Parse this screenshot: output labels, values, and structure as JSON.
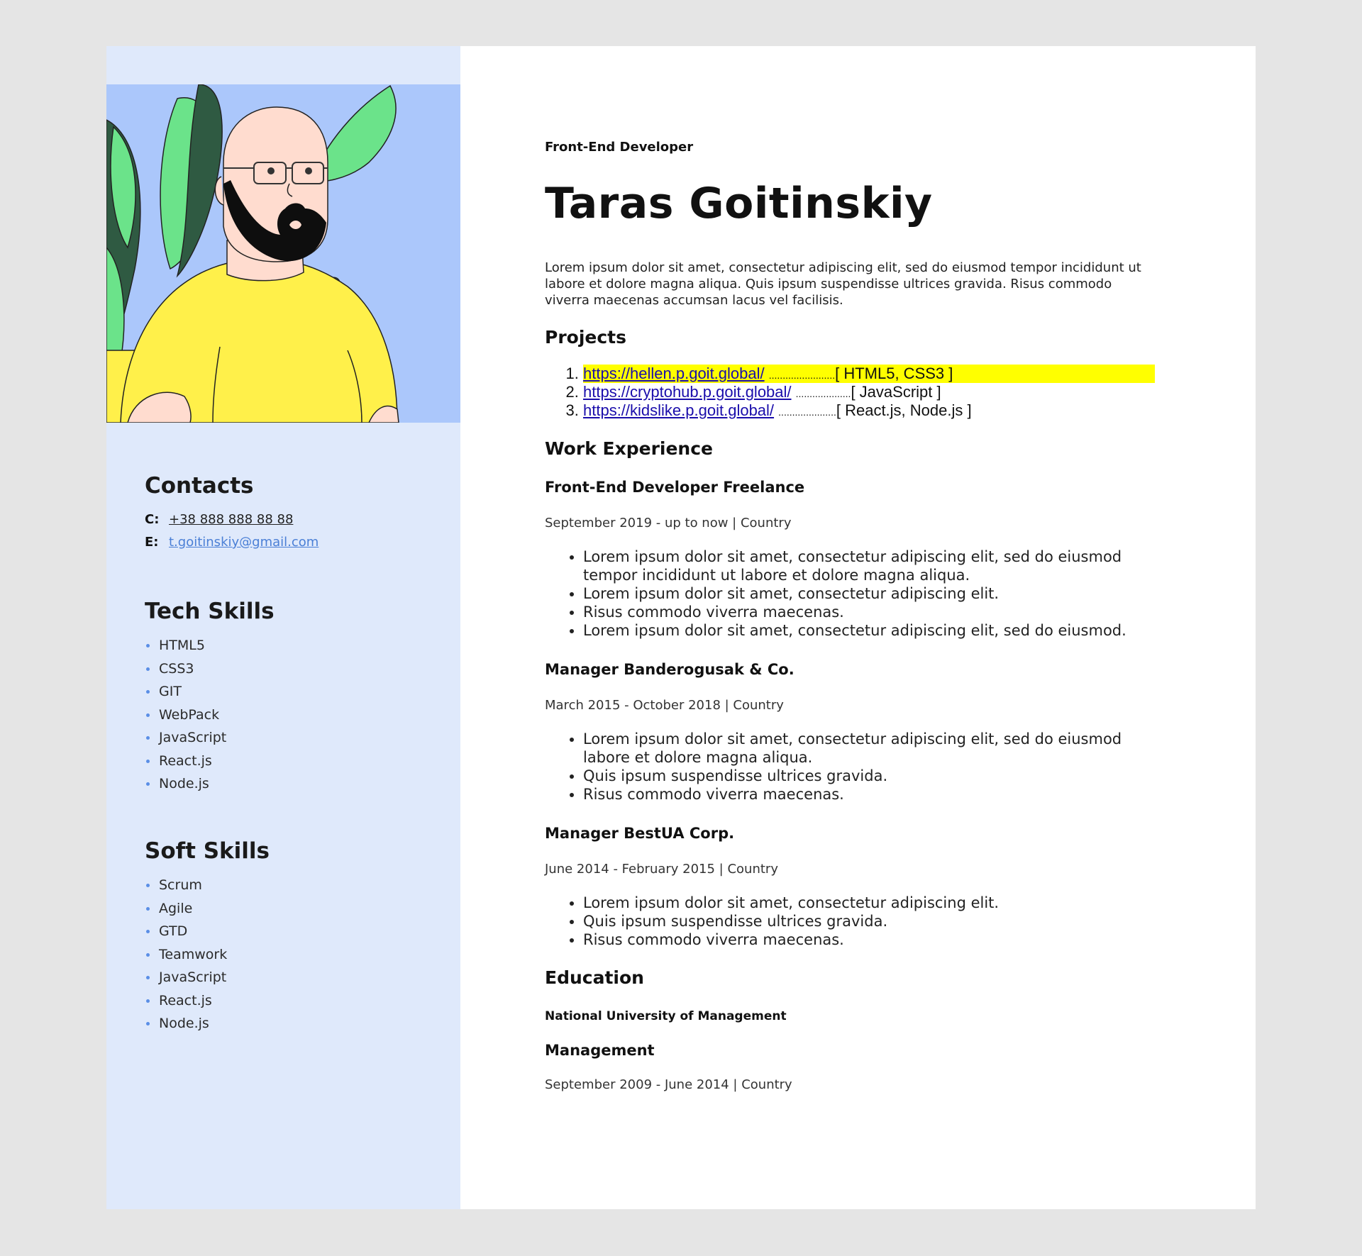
{
  "sidebar": {
    "avatar_alt": "Avatar illustration",
    "contacts": {
      "title": "Contacts",
      "phone_key": "C:",
      "phone": "+38 888 888 88 88",
      "email_key": "E:",
      "email": "t.goitinskiy@gmail.com"
    },
    "tech_skills": {
      "title": "Tech Skills",
      "items": [
        "HTML5",
        "CSS3",
        "GIT",
        "WebPack",
        "JavaScript",
        "React.js",
        "Node.js"
      ]
    },
    "soft_skills": {
      "title": "Soft Skills",
      "items": [
        "Scrum",
        "Agile",
        "GTD",
        "Teamwork",
        "JavaScript",
        "React.js",
        "Node.js"
      ]
    }
  },
  "main": {
    "role": "Front-End Developer",
    "name": "Taras Goitinskiy",
    "intro": "Lorem ipsum dolor sit amet, consectetur adipiscing elit, sed do eiusmod tempor incididunt ut labore et dolore magna aliqua. Quis ipsum suspendisse ultrices gravida. Risus commodo viverra maecenas accumsan lacus vel facilisis.",
    "projects": {
      "title": "Projects",
      "items": [
        {
          "url": "https://hellen.p.goit.global/",
          "dots": "........................",
          "tech": "[ HTML5, CSS3 ]"
        },
        {
          "url": "https://cryptohub.p.goit.global/",
          "dots": "....................",
          "tech": "[ JavaScript ]"
        },
        {
          "url": "https://kidslike.p.goit.global/",
          "dots": ".....................",
          "tech": "[ React.js, Node.js ]"
        }
      ]
    },
    "work": {
      "title": "Work Experience",
      "jobs": [
        {
          "title": "Front-End Developer Freelance",
          "dates": "September 2019 - up to now | Country",
          "bullets": [
            "Lorem ipsum dolor sit amet, consectetur adipiscing elit, sed do eiusmod tempor incididunt ut labore et dolore magna aliqua.",
            "Lorem ipsum dolor sit amet, consectetur adipiscing elit.",
            "Risus commodo viverra maecenas.",
            "Lorem ipsum dolor sit amet, consectetur adipiscing elit, sed do eiusmod."
          ]
        },
        {
          "title": "Manager Banderogusak & Co.",
          "dates": "March 2015 - October 2018 | Country",
          "bullets": [
            "Lorem ipsum dolor sit amet, consectetur adipiscing elit, sed do eiusmod labore et dolore magna aliqua.",
            "Quis ipsum suspendisse ultrices gravida.",
            "Risus commodo viverra maecenas."
          ]
        },
        {
          "title": "Manager BestUA Corp.",
          "dates": "June 2014 - February 2015 | Country",
          "bullets": [
            "Lorem ipsum dolor sit amet, consectetur adipiscing elit.",
            "Quis ipsum suspendisse ultrices gravida.",
            "Risus commodo viverra maecenas."
          ]
        }
      ]
    },
    "education": {
      "title": "Education",
      "school": "National University of Management",
      "degree": "Management",
      "dates": "September 2009 - June 2014 | Country"
    }
  },
  "colors": {
    "page_bg": "#e5e5e5",
    "sidebar_bg": "#dfe9fb",
    "avatar_bg": "#abc7fb",
    "highlight": "#ffff00",
    "link": "#1a0dab",
    "email": "#4a7fd6"
  }
}
